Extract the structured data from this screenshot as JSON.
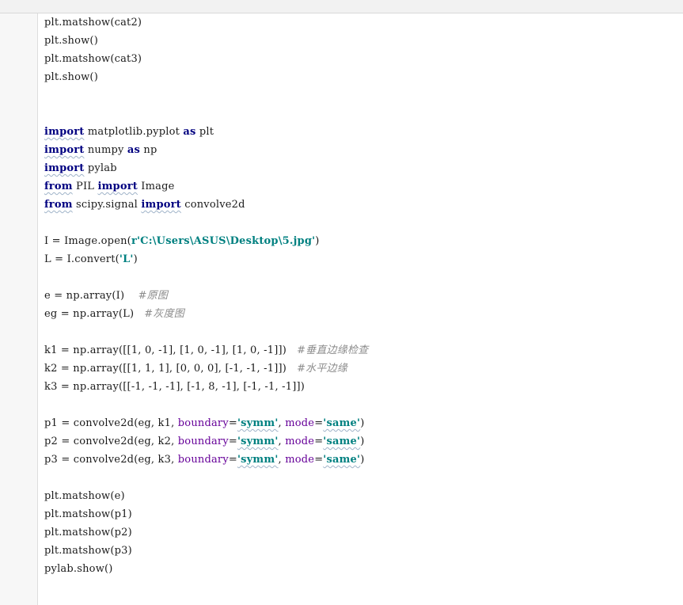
{
  "editor": {
    "lines": [
      [
        {
          "t": "plt.matshow(cat2)",
          "c": "plain"
        }
      ],
      [
        {
          "t": "plt.show()",
          "c": "plain"
        }
      ],
      [
        {
          "t": "plt.matshow(cat3)",
          "c": "plain"
        }
      ],
      [
        {
          "t": "plt.show()",
          "c": "plain"
        }
      ],
      [],
      [],
      [
        {
          "t": "import",
          "c": "kw"
        },
        {
          "t": " matplotlib.pyplot ",
          "c": "plain"
        },
        {
          "t": "as",
          "c": "kw"
        },
        {
          "t": " plt",
          "c": "plain"
        }
      ],
      [
        {
          "t": "import",
          "c": "kw"
        },
        {
          "t": " numpy ",
          "c": "plain"
        },
        {
          "t": "as",
          "c": "kw"
        },
        {
          "t": " np",
          "c": "plain"
        }
      ],
      [
        {
          "t": "import",
          "c": "kw"
        },
        {
          "t": " pylab",
          "c": "plain"
        }
      ],
      [
        {
          "t": "from",
          "c": "kw"
        },
        {
          "t": " PIL ",
          "c": "plain"
        },
        {
          "t": "import",
          "c": "kw"
        },
        {
          "t": " Image",
          "c": "plain"
        }
      ],
      [
        {
          "t": "from",
          "c": "kw"
        },
        {
          "t": " scipy.signal ",
          "c": "plain"
        },
        {
          "t": "import",
          "c": "kw"
        },
        {
          "t": " convolve2d",
          "c": "plain"
        }
      ],
      [],
      [
        {
          "t": "I = Image.open(",
          "c": "plain"
        },
        {
          "t": "r'C:\\Users\\ASUS\\Desktop\\5.jpg'",
          "c": "str"
        },
        {
          "t": ")",
          "c": "plain"
        }
      ],
      [
        {
          "t": "L = I.convert(",
          "c": "plain"
        },
        {
          "t": "'L'",
          "c": "str"
        },
        {
          "t": ")",
          "c": "plain"
        }
      ],
      [],
      [
        {
          "t": "e = np.array(I)    ",
          "c": "plain"
        },
        {
          "t": "#原图",
          "c": "com"
        }
      ],
      [
        {
          "t": "eg = np.array(L)   ",
          "c": "plain"
        },
        {
          "t": "#灰度图",
          "c": "com"
        }
      ],
      [],
      [
        {
          "t": "k1 = np.array([[1, 0, -1], [1, 0, -1], [1, 0, -1]])   ",
          "c": "plain"
        },
        {
          "t": "#垂直边缘检查",
          "c": "com"
        }
      ],
      [
        {
          "t": "k2 = np.array([[1, 1, 1], [0, 0, 0], [-1, -1, -1]])   ",
          "c": "plain"
        },
        {
          "t": "#水平边缘",
          "c": "com"
        }
      ],
      [
        {
          "t": "k3 = np.array([[-1, -1, -1], [-1, 8, -1], [-1, -1, -1]])",
          "c": "plain"
        }
      ],
      [],
      [
        {
          "t": "p1 = convolve2d(eg, k1, ",
          "c": "plain"
        },
        {
          "t": "boundary",
          "c": "param"
        },
        {
          "t": "=",
          "c": "plain"
        },
        {
          "t": "'symm'",
          "c": "str"
        },
        {
          "t": ", ",
          "c": "plain"
        },
        {
          "t": "mode",
          "c": "param"
        },
        {
          "t": "=",
          "c": "plain"
        },
        {
          "t": "'same'",
          "c": "str"
        },
        {
          "t": ")",
          "c": "plain"
        }
      ],
      [
        {
          "t": "p2 = convolve2d(eg, k2, ",
          "c": "plain"
        },
        {
          "t": "boundary",
          "c": "param"
        },
        {
          "t": "=",
          "c": "plain"
        },
        {
          "t": "'symm'",
          "c": "str"
        },
        {
          "t": ", ",
          "c": "plain"
        },
        {
          "t": "mode",
          "c": "param"
        },
        {
          "t": "=",
          "c": "plain"
        },
        {
          "t": "'same'",
          "c": "str"
        },
        {
          "t": ")",
          "c": "plain"
        }
      ],
      [
        {
          "t": "p3 = convolve2d(eg, k3, ",
          "c": "plain"
        },
        {
          "t": "boundary",
          "c": "param"
        },
        {
          "t": "=",
          "c": "plain"
        },
        {
          "t": "'symm'",
          "c": "str"
        },
        {
          "t": ", ",
          "c": "plain"
        },
        {
          "t": "mode",
          "c": "param"
        },
        {
          "t": "=",
          "c": "plain"
        },
        {
          "t": "'same'",
          "c": "str"
        },
        {
          "t": ")",
          "c": "plain"
        }
      ],
      [],
      [
        {
          "t": "plt.matshow(e)",
          "c": "plain"
        }
      ],
      [
        {
          "t": "plt.matshow(p1)",
          "c": "plain"
        }
      ],
      [
        {
          "t": "plt.matshow(p2)",
          "c": "plain"
        }
      ],
      [
        {
          "t": "plt.matshow(p3)",
          "c": "plain"
        }
      ],
      [
        {
          "t": "pylab.show()",
          "c": "plain"
        }
      ]
    ]
  },
  "colors": {
    "keyword": "#000080",
    "string": "#008080",
    "param": "#660099",
    "comment": "#8c8c8c",
    "text": "#1a1a1a"
  }
}
